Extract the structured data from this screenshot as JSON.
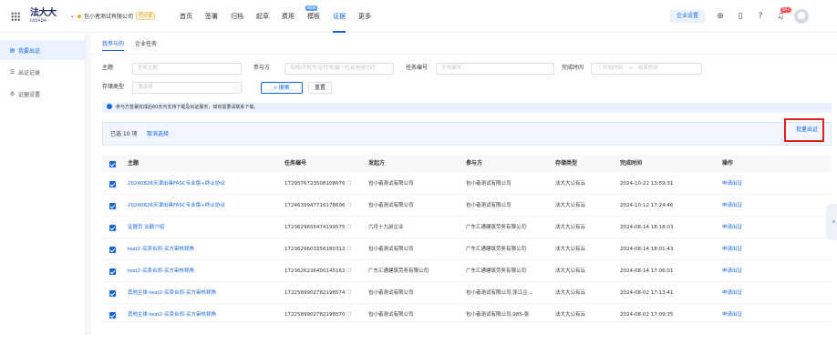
{
  "topbar": {
    "logo_cn": "法大大",
    "logo_en": "FADADA",
    "org_name": "包小者测试有限公司",
    "org_badge": "已认证",
    "nav": [
      {
        "label": "首页",
        "active": false
      },
      {
        "label": "签署",
        "active": false
      },
      {
        "label": "归档",
        "active": false
      },
      {
        "label": "起草",
        "active": false
      },
      {
        "label": "费用",
        "active": false
      },
      {
        "label": "模板",
        "active": false,
        "tag": "NEW"
      },
      {
        "label": "证据",
        "active": true
      },
      {
        "label": "更多",
        "active": false
      }
    ],
    "enterprise_settings": "企业设置",
    "message_count": "99+"
  },
  "sidebar": {
    "items": [
      {
        "label": "我要出证",
        "icon": "document-icon",
        "active": true
      },
      {
        "label": "出证记录",
        "icon": "list-icon",
        "active": false
      },
      {
        "label": "证据设置",
        "icon": "gear-icon",
        "active": false
      }
    ]
  },
  "tabs": [
    {
      "label": "我参与的",
      "active": true
    },
    {
      "label": "企业任务",
      "active": false
    }
  ],
  "filters": {
    "subject_label": "主题",
    "subject_placeholder": "任务主题",
    "participant_label": "参与方",
    "participant_placeholder": "名称/手机号/证件号/统一社会信用代码",
    "task_no_label": "任务编号",
    "task_no_placeholder": "任务编号",
    "complete_time_label": "完成时间",
    "start_placeholder": "开始时间",
    "end_placeholder": "结束时间",
    "storage_label": "存储类型",
    "storage_placeholder": "请选择",
    "search_label": "搜索",
    "reset_label": "重置"
  },
  "notice": "参与方签署完成后60天内支持下载及出证服务，如有需要请联系下载。",
  "selection": {
    "selected_text": "已选 10 项",
    "cancel_text": "取消选择",
    "batch_button": "批量出证"
  },
  "table": {
    "columns": [
      "主题",
      "任务编号",
      "发起方",
      "参与方",
      "存储类型",
      "完成时间",
      "操作"
    ],
    "rows": [
      {
        "subject": "20240826天津出具FASC专业版+终止协议",
        "task_no": "1729576723508108676",
        "initiator": "包小者测试有限公司",
        "participant": "包小者测试有限公司",
        "storage": "法大大公有云",
        "time": "2024-10-22 13:59:31",
        "action": "申请出证"
      },
      {
        "subject": "20240826天津出具FASC专业版+终止协议",
        "task_no": "1724639947716178696",
        "initiator": "包小者测试有限公司",
        "participant": "包小者测试有限公司",
        "storage": "法大大公有云",
        "time": "2024-10-12 17:24:46",
        "action": "申请出证"
      },
      {
        "subject": "证据页 出勤介绍",
        "task_no": "1723629656474199575",
        "initiator": "六月十九前企业",
        "participant": "广东汇通建筑劳务有限公司",
        "storage": "法大大公有云",
        "time": "2024-08-14 18:18:03",
        "action": "申请出证"
      },
      {
        "subject": "test2-买卖合同-买方审核视角",
        "task_no": "1723629603356180312",
        "initiator": "包小者测试有限公司",
        "participant": "广东汇通建筑劳务有限公司",
        "storage": "法大大公有云",
        "time": "2024-08-14 18:01:43",
        "action": "申请出证"
      },
      {
        "subject": "test2-买卖合同-买方审核视角",
        "task_no": "1723626236400145162",
        "initiator": "广东汇通建筑劳务有限公司",
        "participant": "广东汇通建筑劳务有限公司",
        "storage": "法大大公有云",
        "time": "2024-08-14 17:06:01",
        "action": "申请出证"
      },
      {
        "subject": "其他主体-test2-买卖合同-买方审核视角",
        "task_no": "1722589902782198574",
        "initiator": "包小者测试有限公司",
        "participant": "包小者测试有限公司,张江企...",
        "storage": "法大大公有云",
        "time": "2024-08-02 17:13:41",
        "action": "申请出证"
      },
      {
        "subject": "其他主体-test2-买卖合同-买方审核视角",
        "task_no": "1722589902782198570",
        "initiator": "包小者测试有限公司",
        "participant": "包小者测试有限公司,985-张",
        "storage": "法大大公有云",
        "time": "2024-08-02 17:09:35",
        "action": "申请出证"
      }
    ]
  }
}
